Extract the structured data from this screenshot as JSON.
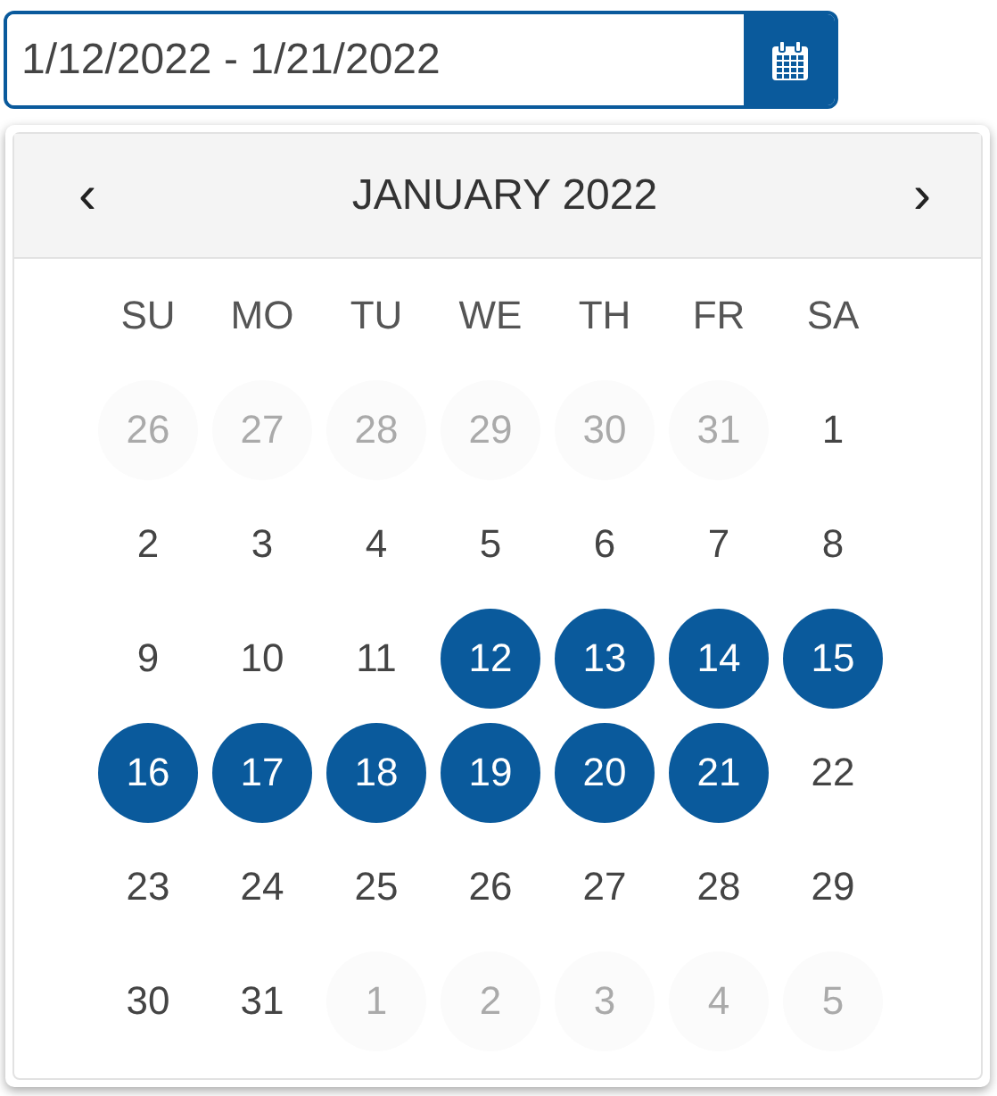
{
  "date_range_field": {
    "value": "1/12/2022 - 1/21/2022"
  },
  "calendar": {
    "prev": "‹",
    "title": "JANUARY 2022",
    "next": "›",
    "weekdays": [
      "SU",
      "MO",
      "TU",
      "WE",
      "TH",
      "FR",
      "SA"
    ],
    "weeks": [
      [
        {
          "day": "26",
          "outside": true,
          "selected": false
        },
        {
          "day": "27",
          "outside": true,
          "selected": false
        },
        {
          "day": "28",
          "outside": true,
          "selected": false
        },
        {
          "day": "29",
          "outside": true,
          "selected": false
        },
        {
          "day": "30",
          "outside": true,
          "selected": false
        },
        {
          "day": "31",
          "outside": true,
          "selected": false
        },
        {
          "day": "1",
          "outside": false,
          "selected": false
        }
      ],
      [
        {
          "day": "2",
          "outside": false,
          "selected": false
        },
        {
          "day": "3",
          "outside": false,
          "selected": false
        },
        {
          "day": "4",
          "outside": false,
          "selected": false
        },
        {
          "day": "5",
          "outside": false,
          "selected": false
        },
        {
          "day": "6",
          "outside": false,
          "selected": false
        },
        {
          "day": "7",
          "outside": false,
          "selected": false
        },
        {
          "day": "8",
          "outside": false,
          "selected": false
        }
      ],
      [
        {
          "day": "9",
          "outside": false,
          "selected": false
        },
        {
          "day": "10",
          "outside": false,
          "selected": false
        },
        {
          "day": "11",
          "outside": false,
          "selected": false
        },
        {
          "day": "12",
          "outside": false,
          "selected": true
        },
        {
          "day": "13",
          "outside": false,
          "selected": true
        },
        {
          "day": "14",
          "outside": false,
          "selected": true
        },
        {
          "day": "15",
          "outside": false,
          "selected": true
        }
      ],
      [
        {
          "day": "16",
          "outside": false,
          "selected": true
        },
        {
          "day": "17",
          "outside": false,
          "selected": true
        },
        {
          "day": "18",
          "outside": false,
          "selected": true
        },
        {
          "day": "19",
          "outside": false,
          "selected": true
        },
        {
          "day": "20",
          "outside": false,
          "selected": true
        },
        {
          "day": "21",
          "outside": false,
          "selected": true
        },
        {
          "day": "22",
          "outside": false,
          "selected": false
        }
      ],
      [
        {
          "day": "23",
          "outside": false,
          "selected": false
        },
        {
          "day": "24",
          "outside": false,
          "selected": false
        },
        {
          "day": "25",
          "outside": false,
          "selected": false
        },
        {
          "day": "26",
          "outside": false,
          "selected": false
        },
        {
          "day": "27",
          "outside": false,
          "selected": false
        },
        {
          "day": "28",
          "outside": false,
          "selected": false
        },
        {
          "day": "29",
          "outside": false,
          "selected": false
        }
      ],
      [
        {
          "day": "30",
          "outside": false,
          "selected": false
        },
        {
          "day": "31",
          "outside": false,
          "selected": false
        },
        {
          "day": "1",
          "outside": true,
          "selected": false
        },
        {
          "day": "2",
          "outside": true,
          "selected": false
        },
        {
          "day": "3",
          "outside": true,
          "selected": false
        },
        {
          "day": "4",
          "outside": true,
          "selected": false
        },
        {
          "day": "5",
          "outside": true,
          "selected": false
        }
      ]
    ]
  }
}
